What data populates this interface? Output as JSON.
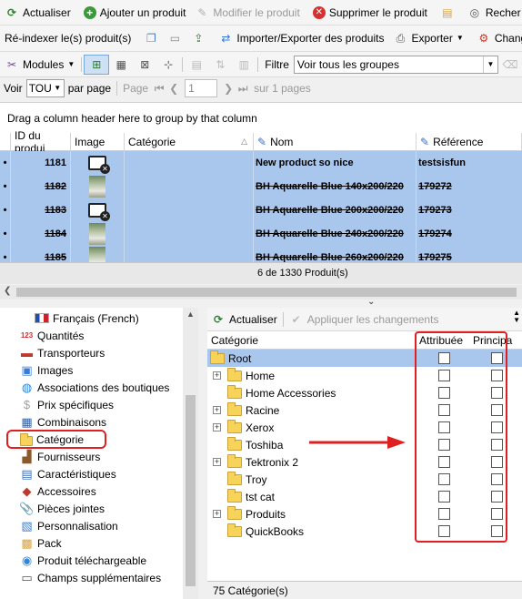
{
  "toolbar1": {
    "refresh": "Actualiser",
    "add": "Ajouter un produit",
    "edit": "Modifier le produit",
    "delete": "Supprimer le produit",
    "search": "Recher"
  },
  "toolbar2": {
    "reindex": "Ré-indexer le(s) produit(s)",
    "import_export": "Importer/Exporter des produits",
    "export": "Exporter",
    "change": "Changeu"
  },
  "toolbar3": {
    "modules": "Modules",
    "filter_label": "Filtre",
    "filter_value": "Voir tous les groupes"
  },
  "pager": {
    "show_label": "Voir",
    "per_page_value": "TOU",
    "per_page_label": "par page",
    "page_label": "Page",
    "page_value": "1",
    "of_pages": "sur 1 pages"
  },
  "group_hint": "Drag a column header here to group by that column",
  "grid": {
    "columns": [
      "ID du produi",
      "Image",
      "Catégorie",
      "Nom",
      "Référence"
    ],
    "rows": [
      {
        "id": "1181",
        "name": "New product so nice",
        "ref": "testsisfun",
        "strike": false,
        "img": "missing"
      },
      {
        "id": "1182",
        "name": "BH Aquarelle Blue 140x200/220",
        "ref": "179272",
        "strike": true,
        "img": "photo"
      },
      {
        "id": "1183",
        "name": "BH Aquarelle Blue 200x200/220",
        "ref": "179273",
        "strike": true,
        "img": "missing"
      },
      {
        "id": "1184",
        "name": "BH Aquarelle Blue 240x200/220",
        "ref": "179274",
        "strike": true,
        "img": "photo"
      },
      {
        "id": "1185",
        "name": "BH Aquarelle Blue 260x200/220",
        "ref": "179275",
        "strike": true,
        "img": "photo"
      }
    ],
    "footer": "6 de 1330 Produit(s)"
  },
  "left_panel": {
    "language": "Français (French)",
    "items": [
      {
        "label": "Quantités",
        "icon": "numbers-icon",
        "color": "#d03030"
      },
      {
        "label": "Transporteurs",
        "icon": "truck-icon",
        "color": "#c0392b"
      },
      {
        "label": "Images",
        "icon": "image-icon",
        "color": "#3a7bd5"
      },
      {
        "label": "Associations des boutiques",
        "icon": "globe-icon",
        "color": "#2e86de"
      },
      {
        "label": "Prix spécifiques",
        "icon": "price-icon",
        "color": "#a0a0a0"
      },
      {
        "label": "Combinaisons",
        "icon": "combinations-icon",
        "color": "#2d5fa8"
      },
      {
        "label": "Catégorie",
        "icon": "folder-icon",
        "color": "#f7d35a"
      },
      {
        "label": "Fournisseurs",
        "icon": "supplier-icon",
        "color": "#8a5a2b"
      },
      {
        "label": "Caractéristiques",
        "icon": "features-icon",
        "color": "#3b6fb6"
      },
      {
        "label": "Accessoires",
        "icon": "accessories-icon",
        "color": "#c0392b"
      },
      {
        "label": "Pièces jointes",
        "icon": "attachment-icon",
        "color": "#888888"
      },
      {
        "label": "Personnalisation",
        "icon": "customize-icon",
        "color": "#3a7bd5"
      },
      {
        "label": "Pack",
        "icon": "pack-icon",
        "color": "#d9a441"
      },
      {
        "label": "Produit téléchargeable",
        "icon": "download-icon",
        "color": "#2e86de"
      },
      {
        "label": "Champs supplémentaires",
        "icon": "fields-icon",
        "color": "#555555"
      }
    ]
  },
  "right_panel": {
    "refresh": "Actualiser",
    "apply": "Appliquer les changements",
    "col_category": "Catégorie",
    "col_assigned": "Attribuée",
    "col_main": "Principa",
    "root": "Root",
    "categories": [
      {
        "label": "Home",
        "expandable": true
      },
      {
        "label": "Home Accessories",
        "expandable": false
      },
      {
        "label": "Racine",
        "expandable": true
      },
      {
        "label": "Xerox",
        "expandable": true
      },
      {
        "label": "Toshiba",
        "expandable": false
      },
      {
        "label": "Tektronix 2",
        "expandable": true
      },
      {
        "label": "Troy",
        "expandable": false
      },
      {
        "label": "tst cat",
        "expandable": false
      },
      {
        "label": "Produits",
        "expandable": true
      },
      {
        "label": "QuickBooks",
        "expandable": false
      }
    ],
    "footer": "75 Catégorie(s)"
  },
  "colors": {
    "selection": "#a9c6ed",
    "highlight": "#e02020",
    "arrow": "#e02020"
  }
}
